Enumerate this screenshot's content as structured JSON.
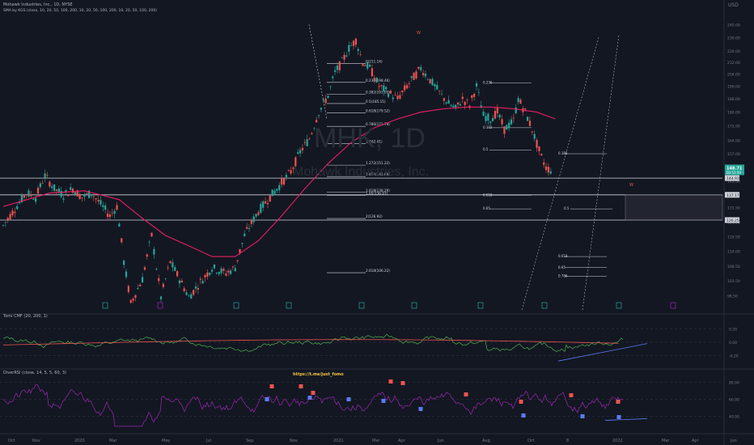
{
  "header": {
    "symbol_line": "Mohawk Industries, Inc., 1D, NYSE",
    "sma_line": "SMA by KGS (close, 10, 20, 50, 100, 200, 10, 20, 50, 100, 200, 10, 20, 50, 100, 200)",
    "cmf_line": "Tomi CMF (20, 200, 1)",
    "rsi_line": "DiverRSI (close, 14, 5, 5, 60, 3)",
    "currency": "USD"
  },
  "watermark": {
    "ticker": "MHK, 1D",
    "name": "Mohawk Industries, Inc."
  },
  "annotation_link": "https://t.me/just_fomo",
  "colors": {
    "background": "#131722",
    "candle_up": "#26a69a",
    "candle_down": "#ef5350",
    "sma": "#e91e63",
    "cmf": "#4caf50",
    "rsi": "#9c27b0",
    "fib": "#d1d4dc",
    "trend": "#5b7cf2",
    "price_label": "#26a69a"
  },
  "chart_data": [
    {
      "type": "candlestick",
      "name": "main",
      "ylim": [
        94,
        248
      ],
      "scale": "log",
      "y_ticks": [
        250.0,
        240.0,
        230.0,
        220.0,
        212.0,
        204.0,
        196.0,
        188.0,
        180.0,
        172.0,
        164.0,
        157.0,
        150.0,
        143.5,
        137.5,
        131.5,
        125.5,
        119.5,
        114.0,
        108.5,
        103.5,
        98.5,
        93.6
      ],
      "x_ticks": [
        "Oct",
        "Nov",
        "2020",
        "Mar",
        "May",
        "Jul",
        "Sep",
        "Nov",
        "2021",
        "Mar",
        "Apr",
        "Jun",
        "Aug",
        "Oct",
        "8",
        "2022",
        "Mar",
        "Apr",
        "Jun"
      ],
      "price_path": [
        [
          0,
          124
        ],
        [
          5,
          131
        ],
        [
          10,
          138
        ],
        [
          14,
          136
        ],
        [
          18,
          146
        ],
        [
          22,
          140
        ],
        [
          26,
          137
        ],
        [
          30,
          140
        ],
        [
          34,
          136
        ],
        [
          38,
          138
        ],
        [
          42,
          133
        ],
        [
          46,
          128
        ],
        [
          49,
          132
        ],
        [
          52,
          110
        ],
        [
          55,
          96
        ],
        [
          60,
          104
        ],
        [
          64,
          120
        ],
        [
          66,
          108
        ],
        [
          68,
          98
        ],
        [
          72,
          110
        ],
        [
          76,
          104
        ],
        [
          80,
          98
        ],
        [
          85,
          103
        ],
        [
          90,
          108
        ],
        [
          96,
          106
        ],
        [
          100,
          108
        ],
        [
          104,
          120
        ],
        [
          110,
          130
        ],
        [
          114,
          135
        ],
        [
          118,
          140
        ],
        [
          124,
          148
        ],
        [
          128,
          158
        ],
        [
          132,
          165
        ],
        [
          136,
          180
        ],
        [
          140,
          190
        ],
        [
          143,
          205
        ],
        [
          146,
          212
        ],
        [
          149,
          222
        ],
        [
          152,
          228
        ],
        [
          155,
          212
        ],
        [
          158,
          208
        ],
        [
          162,
          196
        ],
        [
          166,
          192
        ],
        [
          170,
          188
        ],
        [
          173,
          194
        ],
        [
          176,
          200
        ],
        [
          180,
          208
        ],
        [
          183,
          202
        ],
        [
          186,
          196
        ],
        [
          189,
          190
        ],
        [
          192,
          185
        ],
        [
          195,
          182
        ],
        [
          198,
          188
        ],
        [
          201,
          184
        ],
        [
          204,
          196
        ],
        [
          207,
          178
        ],
        [
          210,
          176
        ],
        [
          213,
          180
        ],
        [
          216,
          170
        ],
        [
          220,
          175
        ],
        [
          222,
          188
        ],
        [
          225,
          180
        ],
        [
          228,
          170
        ],
        [
          230,
          162
        ],
        [
          232,
          155
        ],
        [
          234,
          150
        ],
        [
          236,
          148.71
        ]
      ],
      "last_price": "148.71",
      "last_change": "00:53:59",
      "sma_path": [
        [
          0,
          132
        ],
        [
          20,
          138
        ],
        [
          35,
          139
        ],
        [
          50,
          135
        ],
        [
          60,
          127
        ],
        [
          70,
          120
        ],
        [
          80,
          116
        ],
        [
          90,
          112
        ],
        [
          100,
          112
        ],
        [
          110,
          118
        ],
        [
          120,
          128
        ],
        [
          130,
          140
        ],
        [
          140,
          152
        ],
        [
          150,
          163
        ],
        [
          160,
          171
        ],
        [
          170,
          176
        ],
        [
          180,
          180
        ],
        [
          190,
          182
        ],
        [
          200,
          183
        ],
        [
          210,
          183
        ],
        [
          220,
          182
        ],
        [
          230,
          180
        ],
        [
          238,
          176
        ]
      ],
      "fib_left": {
        "levels": [
          {
            "label": "0(211.14)",
            "price": 211.14
          },
          {
            "label": "0.236(198.46)",
            "price": 198.46
          },
          {
            "label": "0.382(191.00)",
            "price": 191.0
          },
          {
            "label": "0.5(185.15)",
            "price": 185.15
          },
          {
            "label": "0.618(179.52)",
            "price": 179.52
          },
          {
            "label": "0.786(171.79)",
            "price": 171.79
          },
          {
            "label": "1(162.41)",
            "price": 162.41
          },
          {
            "label": "1.272(151.22)",
            "price": 151.22
          },
          {
            "label": "1.414(145.69)",
            "price": 145.69
          },
          {
            "label": "1.618(138.29)",
            "price": 138.29
          },
          {
            "label": "1.65(136.97)",
            "price": 136.97
          },
          {
            "label": "2(126.92)",
            "price": 126.92
          },
          {
            "label": "2.618(106.22)",
            "price": 106.22
          }
        ]
      },
      "fib_right": [
        "0.236",
        "0.382",
        "0.5",
        "0.382",
        "0.618",
        "0.65",
        "0.5",
        "0.618",
        "0.65",
        "0.786"
      ],
      "hlines": [
        {
          "price": 144.93,
          "label": "144.93"
        },
        {
          "price": 137.17,
          "label": "137.17"
        },
        {
          "price": 126.25,
          "label": "126.25"
        }
      ],
      "markers": [
        "W",
        "W",
        "W"
      ]
    },
    {
      "type": "line",
      "name": "cmf",
      "ylim": [
        -0.35,
        0.35
      ],
      "y_ticks": [
        "0.20",
        "0.00",
        "-0.20"
      ]
    },
    {
      "type": "line",
      "name": "rsi",
      "ylim": [
        25,
        90
      ],
      "y_ticks": [
        "80.00",
        "60.00",
        "40.00",
        "20.00"
      ]
    }
  ]
}
